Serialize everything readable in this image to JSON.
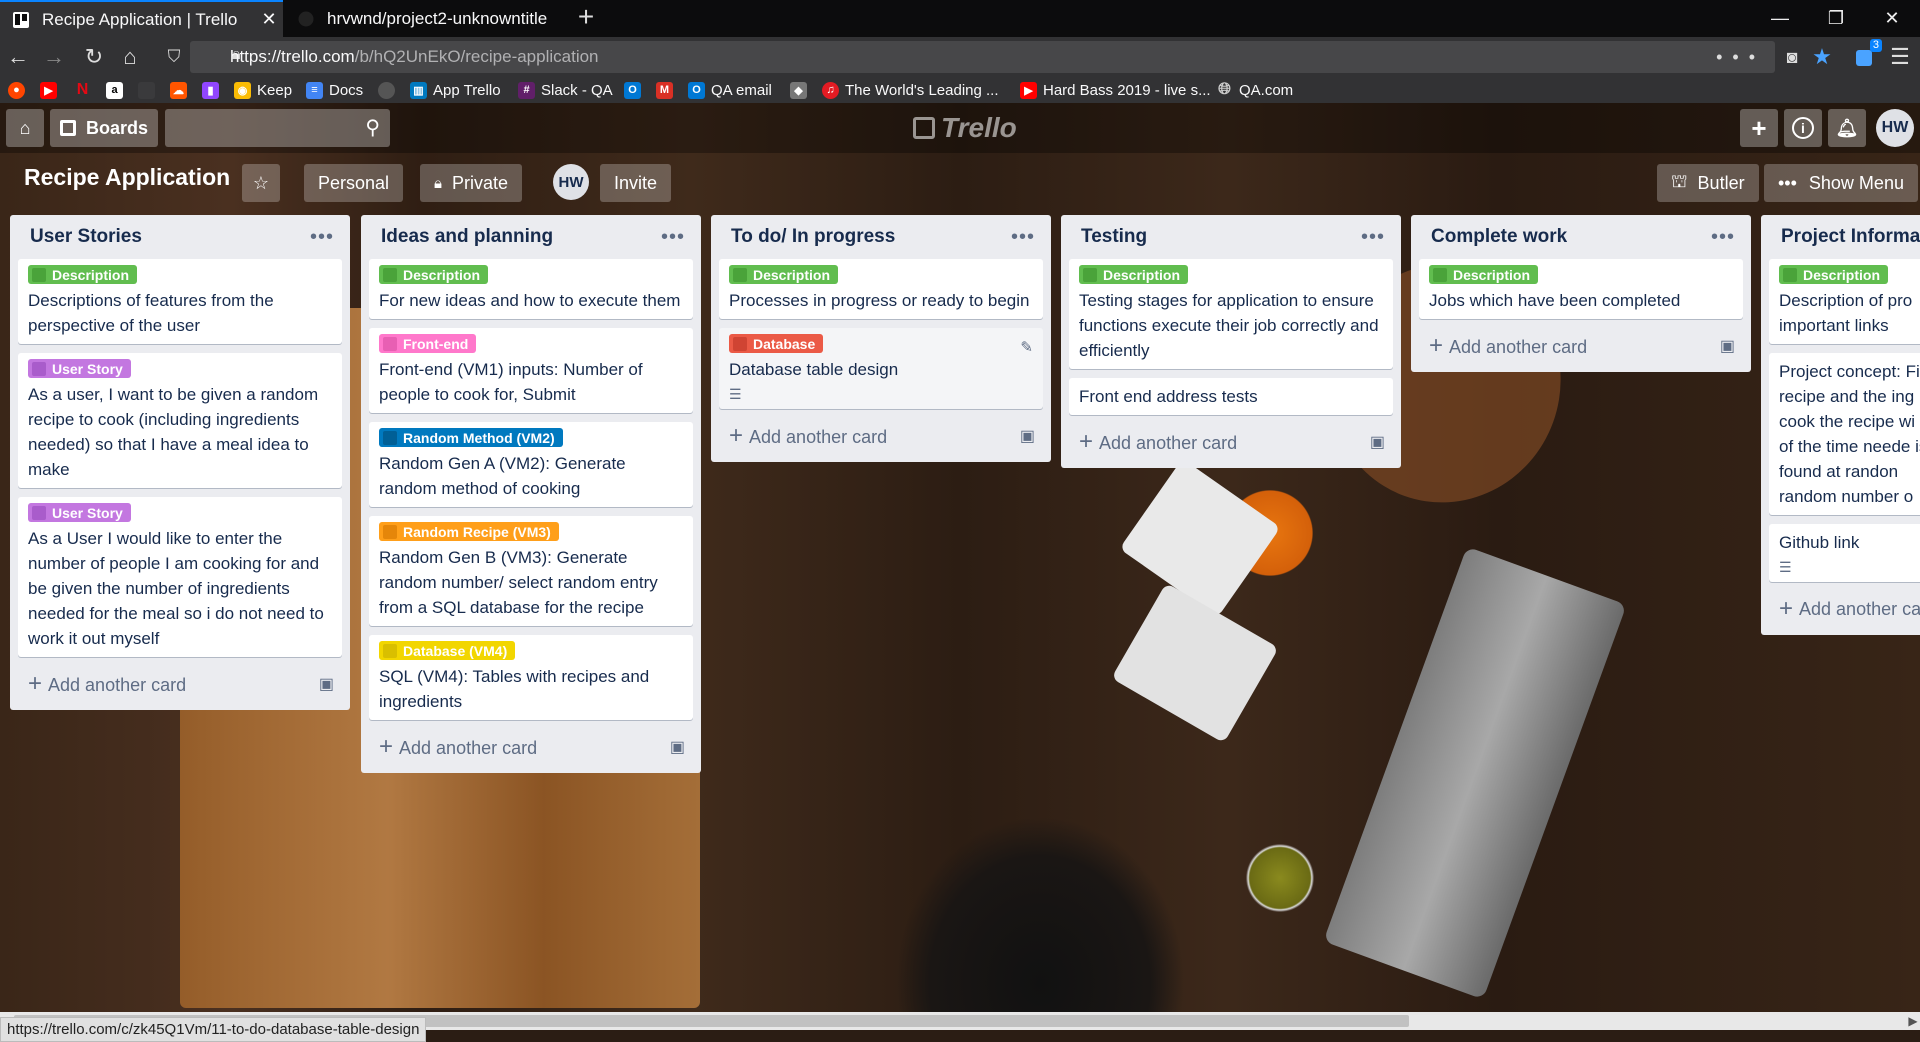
{
  "browser": {
    "tabs": [
      {
        "title": "Recipe Application | Trello",
        "active": true
      },
      {
        "title": "hrvwnd/project2-unknowntitle",
        "active": false
      }
    ],
    "url_host": "https://trello.com",
    "url_path": "/b/hQ2UnEkO/recipe-application",
    "extension_badge": "3",
    "bookmarks": [
      {
        "label": "",
        "icon": "reddit-icon",
        "color": "#ff4500"
      },
      {
        "label": "",
        "icon": "youtube-icon",
        "color": "#ff0000"
      },
      {
        "label": "",
        "icon": "netflix-icon",
        "color": "#e50914"
      },
      {
        "label": "",
        "icon": "amazon-icon",
        "color": "#ffffff"
      },
      {
        "label": "",
        "icon": "blank-icon",
        "color": "#444444"
      },
      {
        "label": "",
        "icon": "soundcloud-icon",
        "color": "#ff5500"
      },
      {
        "label": "",
        "icon": "twitch-icon",
        "color": "#9146ff"
      },
      {
        "label": "Keep",
        "icon": "keep-icon",
        "color": "#fbbc04"
      },
      {
        "label": "Docs",
        "icon": "docs-icon",
        "color": "#4285f4"
      },
      {
        "label": "",
        "icon": "github-icon",
        "color": "#333333"
      },
      {
        "label": "App Trello",
        "icon": "trello-icon",
        "color": "#0079bf"
      },
      {
        "label": "Slack - QA",
        "icon": "slack-icon",
        "color": "#611f69"
      },
      {
        "label": "",
        "icon": "outlook-icon",
        "color": "#0078d4"
      },
      {
        "label": "",
        "icon": "gmail-icon",
        "color": "#d93025"
      },
      {
        "label": "QA email",
        "icon": "outlook-icon",
        "color": "#0078d4"
      },
      {
        "label": "",
        "icon": "extension-icon",
        "color": "#888888"
      },
      {
        "label": "The World's Leading ...",
        "icon": "headset-icon",
        "color": "#e31b23"
      },
      {
        "label": "Hard Bass 2019 - live s...",
        "icon": "youtube-icon",
        "color": "#ff0000"
      },
      {
        "label": "QA.com",
        "icon": "globe-icon",
        "color": "#bbbbbb"
      }
    ],
    "status_link": "https://trello.com/c/zk45Q1Vm/11-to-do-database-table-design"
  },
  "header": {
    "boards_label": "Boards",
    "logo_text": "Trello",
    "avatar_initials": "HW"
  },
  "boardbar": {
    "title": "Recipe Application",
    "team": "Personal",
    "visibility": "Private",
    "member_initials": "HW",
    "invite": "Invite",
    "butler": "Butler",
    "show_menu": "Show Menu"
  },
  "add_card_label": "Add another card",
  "lists": [
    {
      "title": "User Stories",
      "cards": [
        {
          "label": "Description",
          "label_color": "#61bd4f",
          "text": "Descriptions of features from the perspective of the user"
        },
        {
          "label": "User Story",
          "label_color": "#c377e0",
          "text": "As a user, I want to be given a random recipe to cook (including ingredients needed) so that I have a meal idea to make"
        },
        {
          "label": "User Story",
          "label_color": "#c377e0",
          "text": "As a User I would like to enter the number of people I am cooking for and be given the number of ingredients needed for the meal so i do not need to work it out myself"
        }
      ]
    },
    {
      "title": "Ideas and planning",
      "cards": [
        {
          "label": "Description",
          "label_color": "#61bd4f",
          "text": "For new ideas and how to execute them"
        },
        {
          "label": "Front-end",
          "label_color": "#ff78cb",
          "text": "Front-end (VM1) inputs: Number of people to cook for, Submit"
        },
        {
          "label": "Random Method (VM2)",
          "label_color": "#0079bf",
          "text": "Random Gen A (VM2): Generate random method of cooking"
        },
        {
          "label": "Random Recipe (VM3)",
          "label_color": "#ff9f1a",
          "text": "Random Gen B (VM3): Generate random number/ select random entry from a SQL database for the recipe"
        },
        {
          "label": "Database (VM4)",
          "label_color": "#f2d600",
          "text": "SQL (VM4): Tables with recipes and ingredients"
        }
      ]
    },
    {
      "title": "To do/ In progress",
      "cards": [
        {
          "label": "Description",
          "label_color": "#61bd4f",
          "text": "Processes in progress or ready to begin"
        },
        {
          "label": "Database",
          "label_color": "#eb5a46",
          "text": "Database table design",
          "has_description": true,
          "hovered": true
        }
      ]
    },
    {
      "title": "Testing",
      "cards": [
        {
          "label": "Description",
          "label_color": "#61bd4f",
          "text": "Testing stages for application to ensure functions execute their job correctly and efficiently"
        },
        {
          "label": "",
          "label_color": "",
          "text": "Front end address tests"
        }
      ]
    },
    {
      "title": "Complete work",
      "cards": [
        {
          "label": "Description",
          "label_color": "#61bd4f",
          "text": "Jobs which have been completed"
        }
      ]
    },
    {
      "title": "Project Informatic",
      "cards": [
        {
          "label": "Description",
          "label_color": "#61bd4f",
          "text": "Description of pro important links"
        },
        {
          "label": "",
          "label_color": "",
          "text": "Project concept: Fi recipe and the ing cook the recipe wi of the time neede is found at randon random number o"
        },
        {
          "label": "",
          "label_color": "",
          "text": "Github link",
          "has_description": true
        }
      ],
      "add_card": "Add another ca"
    }
  ]
}
